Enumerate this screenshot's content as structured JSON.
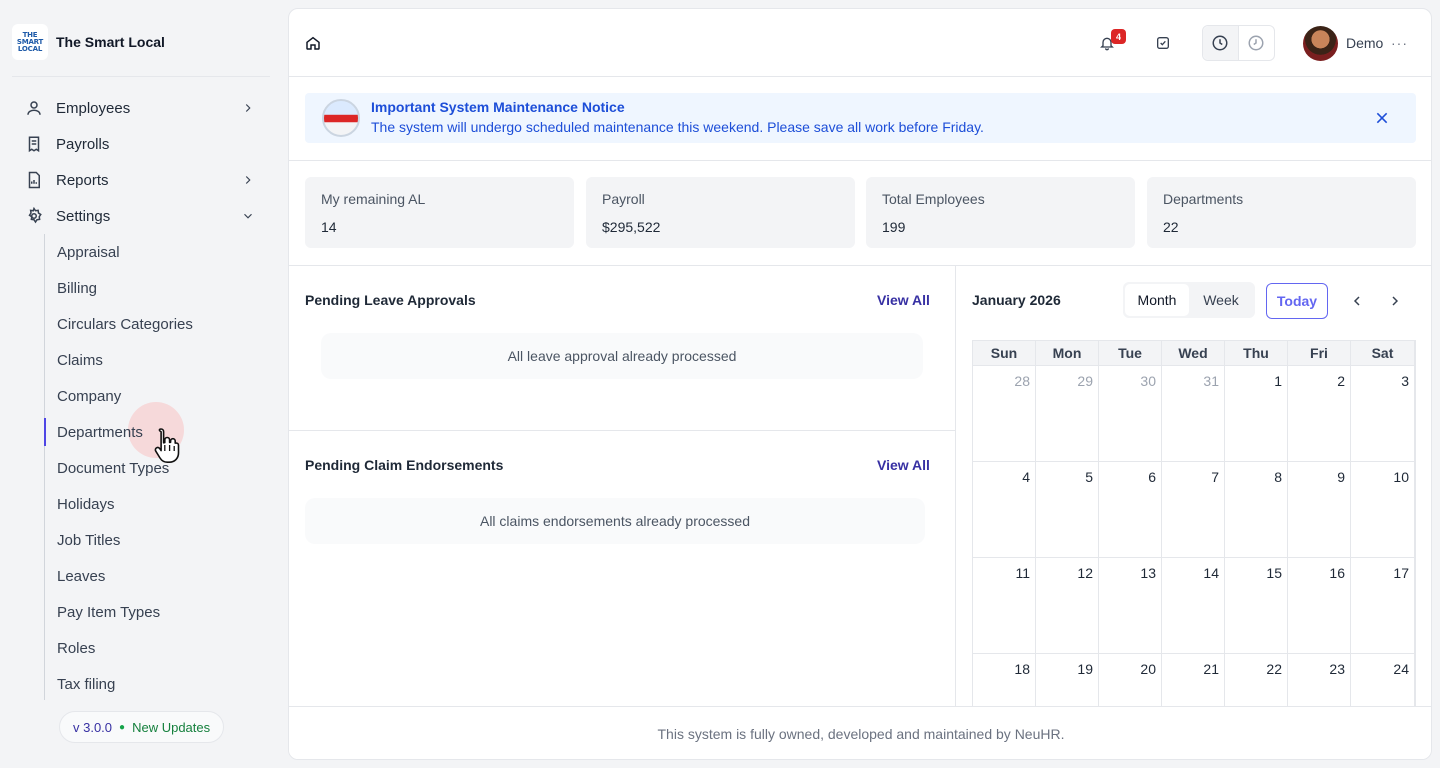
{
  "brand": {
    "name": "The Smart Local",
    "logo_text": "THE SMART LOCAL"
  },
  "sidebar": {
    "items": [
      {
        "label": "Employees",
        "icon": "user-icon",
        "chevron": "right"
      },
      {
        "label": "Payrolls",
        "icon": "receipt-icon",
        "chevron": ""
      },
      {
        "label": "Reports",
        "icon": "report-icon",
        "chevron": "right"
      },
      {
        "label": "Settings",
        "icon": "gear-icon",
        "chevron": "down"
      }
    ],
    "settings_items": [
      "Appraisal",
      "Billing",
      "Circulars Categories",
      "Claims",
      "Company",
      "Departments",
      "Document Types",
      "Holidays",
      "Job Titles",
      "Leaves",
      "Pay Item Types",
      "Roles",
      "Tax filing"
    ],
    "active_settings_item": "Departments",
    "version": "v 3.0.0",
    "updates_label": "New Updates"
  },
  "topbar": {
    "notification_count": "4",
    "user_name": "Demo",
    "icons": [
      "home-icon",
      "bell-icon",
      "task-check-icon",
      "clock-in-icon",
      "clock-out-icon",
      "more-icon"
    ]
  },
  "notice": {
    "title": "Important System Maintenance Notice",
    "text": "The system will undergo scheduled maintenance this weekend. Please save all work before Friday."
  },
  "stats": [
    {
      "label": "My remaining AL",
      "value": "14"
    },
    {
      "label": "Payroll",
      "value": "$295,522"
    },
    {
      "label": "Total Employees",
      "value": "199"
    },
    {
      "label": "Departments",
      "value": "22"
    }
  ],
  "leave": {
    "title": "Pending Leave Approvals",
    "view_all": "View All",
    "empty": "All leave approval already processed"
  },
  "claims": {
    "title": "Pending Claim Endorsements",
    "view_all": "View All",
    "empty": "All claims endorsements already processed"
  },
  "calendar": {
    "title": "January 2026",
    "view_options": [
      "Month",
      "Week"
    ],
    "active_view": "Month",
    "today_label": "Today",
    "weekdays": [
      "Sun",
      "Mon",
      "Tue",
      "Wed",
      "Thu",
      "Fri",
      "Sat"
    ],
    "weeks": [
      [
        {
          "d": "28",
          "m": true
        },
        {
          "d": "29",
          "m": true
        },
        {
          "d": "30",
          "m": true
        },
        {
          "d": "31",
          "m": true
        },
        {
          "d": "1"
        },
        {
          "d": "2"
        },
        {
          "d": "3"
        }
      ],
      [
        {
          "d": "4"
        },
        {
          "d": "5"
        },
        {
          "d": "6"
        },
        {
          "d": "7"
        },
        {
          "d": "8"
        },
        {
          "d": "9"
        },
        {
          "d": "10"
        }
      ],
      [
        {
          "d": "11"
        },
        {
          "d": "12"
        },
        {
          "d": "13"
        },
        {
          "d": "14"
        },
        {
          "d": "15"
        },
        {
          "d": "16"
        },
        {
          "d": "17"
        }
      ],
      [
        {
          "d": "18"
        },
        {
          "d": "19"
        },
        {
          "d": "20"
        },
        {
          "d": "21"
        },
        {
          "d": "22"
        },
        {
          "d": "23"
        },
        {
          "d": "24"
        }
      ]
    ]
  },
  "footer": {
    "text": "This system is fully owned, developed and maintained by NeuHR."
  }
}
